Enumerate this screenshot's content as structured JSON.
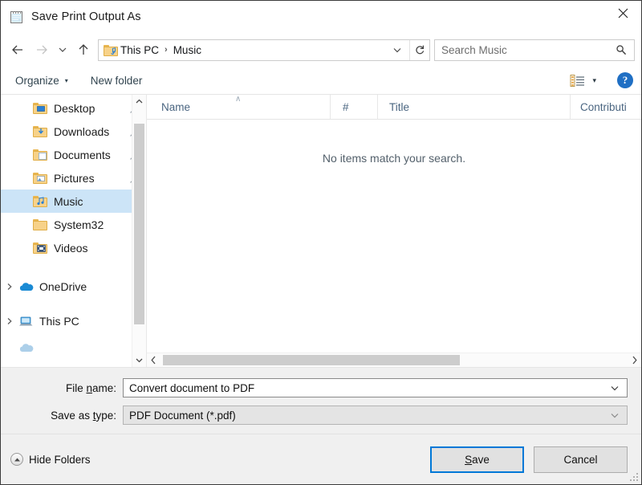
{
  "window": {
    "title": "Save Print Output As",
    "icon": "notepad-icon",
    "close_label": "✕"
  },
  "nav": {
    "back_icon": "back-arrow-icon",
    "forward_icon": "forward-arrow-icon",
    "recent_icon": "chevron-down-icon",
    "up_icon": "up-arrow-icon",
    "address": {
      "folder_icon": "music-folder-icon",
      "crumbs": [
        "This PC",
        "Music"
      ],
      "separator": "›",
      "dropdown_icon": "chevron-down-icon",
      "refresh_icon": "refresh-icon"
    },
    "search": {
      "placeholder": "Search Music",
      "icon": "search-icon"
    }
  },
  "commandbar": {
    "organize": "Organize",
    "organize_caret": "▾",
    "new_folder": "New folder",
    "view_icon": "view-options-icon",
    "view_caret": "▾",
    "help_label": "?"
  },
  "sidebar": {
    "items": [
      {
        "label": "Desktop",
        "icon": "desktop-folder-icon",
        "pinned": true,
        "selected": false,
        "expandable": false
      },
      {
        "label": "Downloads",
        "icon": "downloads-folder-icon",
        "pinned": true,
        "selected": false,
        "expandable": false
      },
      {
        "label": "Documents",
        "icon": "documents-folder-icon",
        "pinned": true,
        "selected": false,
        "expandable": false
      },
      {
        "label": "Pictures",
        "icon": "pictures-folder-icon",
        "pinned": true,
        "selected": false,
        "expandable": false
      },
      {
        "label": "Music",
        "icon": "music-folder-icon",
        "pinned": false,
        "selected": true,
        "expandable": false
      },
      {
        "label": "System32",
        "icon": "folder-icon",
        "pinned": false,
        "selected": false,
        "expandable": false
      },
      {
        "label": "Videos",
        "icon": "videos-folder-icon",
        "pinned": false,
        "selected": false,
        "expandable": false
      },
      {
        "label": "OneDrive",
        "icon": "onedrive-cloud-icon",
        "pinned": false,
        "selected": false,
        "expandable": true
      },
      {
        "label": "This PC",
        "icon": "this-pc-icon",
        "pinned": false,
        "selected": false,
        "expandable": true
      }
    ],
    "scroll_up_icon": "∧",
    "scroll_down_icon": "∨"
  },
  "filelist": {
    "columns": [
      {
        "label": "Name",
        "sorted": "asc"
      },
      {
        "label": "#"
      },
      {
        "label": "Title"
      },
      {
        "label": "Contributi"
      }
    ],
    "sort_caret": "∧",
    "empty_message": "No items match your search.",
    "hscroll_left_icon": "‹",
    "hscroll_right_icon": "›"
  },
  "form": {
    "filename": {
      "label_pre": "File ",
      "label_accel": "n",
      "label_post": "ame:",
      "value": "Convert document to PDF",
      "chevron": "∨"
    },
    "savetype": {
      "label_pre": "Save as ",
      "label_accel": "t",
      "label_post": "ype:",
      "value": "PDF Document (*.pdf)",
      "chevron": "∨"
    }
  },
  "footer": {
    "hide_folders": "Hide Folders",
    "hide_folders_icon": "collapse-up-icon",
    "save_pre": "",
    "save_accel": "S",
    "save_post": "ave",
    "cancel": "Cancel"
  },
  "colors": {
    "accent": "#0078d7",
    "selection": "#cce4f7",
    "form_bg": "#f0f0f0",
    "help_blue": "#1f6fc4"
  }
}
